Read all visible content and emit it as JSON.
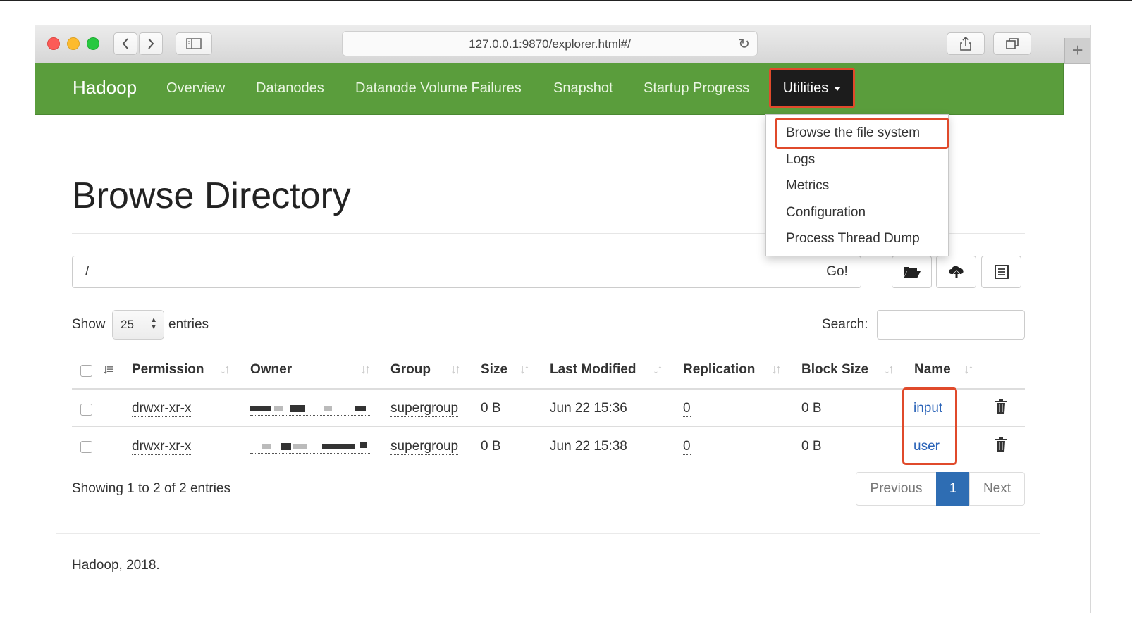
{
  "browser": {
    "url": "127.0.0.1:9870/explorer.html#/",
    "back_icon": "chevron-left-icon",
    "forward_icon": "chevron-right-icon"
  },
  "navbar": {
    "brand": "Hadoop",
    "items": [
      "Overview",
      "Datanodes",
      "Datanode Volume Failures",
      "Snapshot",
      "Startup Progress"
    ],
    "utilities_label": "Utilities",
    "color": "#5a9d3c"
  },
  "dropdown": {
    "items": [
      "Browse the file system",
      "Logs",
      "Metrics",
      "Configuration",
      "Process Thread Dump"
    ]
  },
  "page": {
    "title": "Browse Directory",
    "path_value": "/",
    "go_label": "Go!"
  },
  "table_controls": {
    "show_label": "Show",
    "page_size": "25",
    "entries_label": "entries",
    "search_label": "Search:"
  },
  "table": {
    "headers": [
      "Permission",
      "Owner",
      "Group",
      "Size",
      "Last Modified",
      "Replication",
      "Block Size",
      "Name"
    ],
    "rows": [
      {
        "permission": "drwxr-xr-x",
        "group": "supergroup",
        "size": "0 B",
        "modified": "Jun 22 15:36",
        "replication": "0",
        "block_size": "0 B",
        "name": "input"
      },
      {
        "permission": "drwxr-xr-x",
        "group": "supergroup",
        "size": "0 B",
        "modified": "Jun 22 15:38",
        "replication": "0",
        "block_size": "0 B",
        "name": "user"
      }
    ]
  },
  "pagination": {
    "summary": "Showing 1 to 2 of 2 entries",
    "previous": "Previous",
    "current": "1",
    "next": "Next"
  },
  "footer": {
    "text": "Hadoop, 2018."
  },
  "colors": {
    "highlight": "#e04a2b",
    "link": "#2a63b8",
    "active_page": "#2e6db3"
  }
}
